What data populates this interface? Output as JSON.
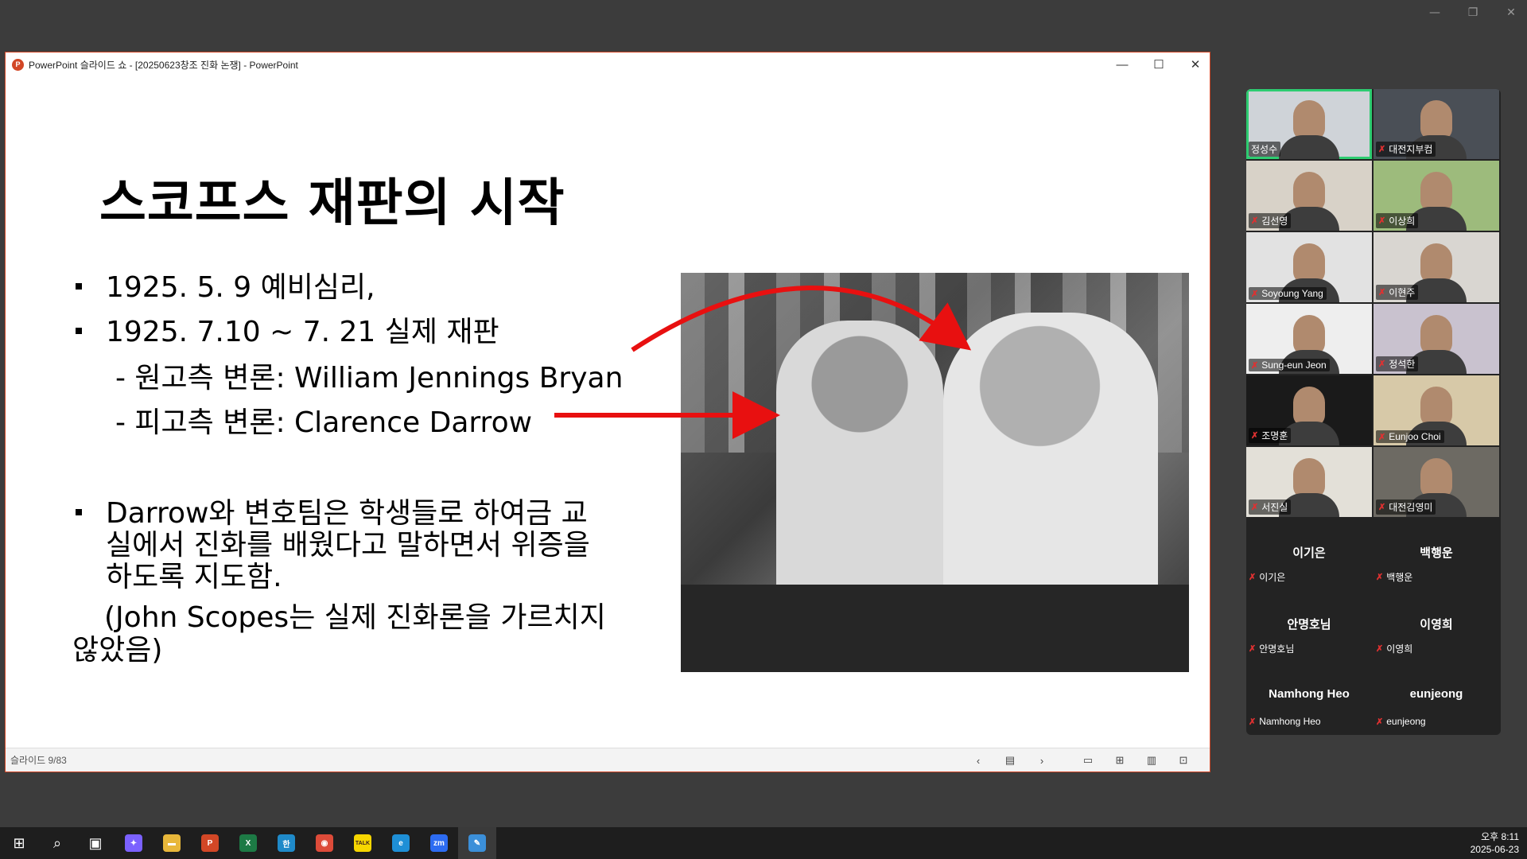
{
  "ppt": {
    "window_title": "PowerPoint 슬라이드 쇼 - [20250623창조 진화 논쟁] - PowerPoint",
    "logo_letter": "P",
    "minimize": "—",
    "maximize": "☐",
    "close": "✕"
  },
  "slide": {
    "title": "스코프스 재판의 시작",
    "bullet1": "1925. 5. 9   예비심리,",
    "bullet2": "1925. 7.10 ~ 7. 21   실제 재판",
    "sub1": "- 원고측 변론: William Jennings Bryan",
    "sub2": "- 피고측 변론: Clarence Darrow",
    "bullet3_line1": "Darrow와 변호팀은 학생들로 하여금 교",
    "bullet3_line2": "실에서 진화를 배웠다고 말하면서 위증을",
    "bullet3_line3": "하도록 지도함.",
    "note_line1": "(John Scopes는 실제 진화론을 가르치지",
    "note_line2": "않았음)",
    "arrow_color": "#e81010"
  },
  "statusbar": {
    "slide_counter": "슬라이드 9/83",
    "icons": [
      "chevron-left-icon",
      "notes-icon",
      "chevron-right-icon",
      "normal-view-icon",
      "slide-sorter-icon",
      "reading-view-icon",
      "slideshow-icon"
    ]
  },
  "participants": {
    "video_tiles": [
      {
        "name": "정성수",
        "muted": false,
        "active": true,
        "bg": "#cfd3d8"
      },
      {
        "name": "대전지부컴",
        "muted": true,
        "active": false,
        "bg": "#4a4f56"
      },
      {
        "name": "김선영",
        "muted": true,
        "active": false,
        "bg": "#d8d2c8"
      },
      {
        "name": "이상희",
        "muted": true,
        "active": false,
        "bg": "#9dbb7c"
      },
      {
        "name": "Soyoung Yang",
        "muted": true,
        "active": false,
        "bg": "#e2e2e2"
      },
      {
        "name": "이현주",
        "muted": true,
        "active": false,
        "bg": "#d9d6d1"
      },
      {
        "name": "Sung-eun Jeon",
        "muted": true,
        "active": false,
        "bg": "#eeeeee"
      },
      {
        "name": "정석한",
        "muted": true,
        "active": false,
        "bg": "#c9c2cf"
      },
      {
        "name": "조명훈",
        "muted": true,
        "active": false,
        "bg": "#1a1a1a"
      },
      {
        "name": "Eunjoo Choi",
        "muted": true,
        "active": false,
        "bg": "#d7c9a8"
      },
      {
        "name": "서진실",
        "muted": true,
        "active": false,
        "bg": "#e3e0d8"
      },
      {
        "name": "대전김영미",
        "muted": true,
        "active": false,
        "bg": "#6d6a63"
      }
    ],
    "audio_tiles": [
      {
        "display": "이기은",
        "name": "이기은"
      },
      {
        "display": "백행운",
        "name": "백행운"
      },
      {
        "display": "안명호님",
        "name": "안명호님"
      },
      {
        "display": "이영희",
        "name": "이영희"
      },
      {
        "display": "Namhong Heo",
        "name": "Namhong Heo"
      },
      {
        "display": "eunjeong",
        "name": "eunjeong"
      }
    ],
    "muted_mic_glyph": "✗"
  },
  "taskbar": {
    "apps": [
      {
        "icon": "windows-start-icon",
        "glyph": "⊞",
        "color": "#1e1e1e"
      },
      {
        "icon": "search-icon",
        "glyph": "⌕",
        "color": "#1e1e1e"
      },
      {
        "icon": "task-view-icon",
        "glyph": "▣",
        "color": "#1e1e1e"
      },
      {
        "icon": "copilot-icon",
        "glyph": "✦",
        "color": "#7b61ff"
      },
      {
        "icon": "file-explorer-icon",
        "glyph": "▬",
        "color": "#e8b73a"
      },
      {
        "icon": "powerpoint-icon",
        "glyph": "P",
        "color": "#d24726"
      },
      {
        "icon": "excel-icon",
        "glyph": "X",
        "color": "#1d7a45"
      },
      {
        "icon": "hancom-icon",
        "glyph": "한",
        "color": "#1f8ac9"
      },
      {
        "icon": "chrome-icon",
        "glyph": "◉",
        "color": "#dd4b39"
      },
      {
        "icon": "kakaotalk-icon",
        "glyph": "TALK",
        "color": "#f7d600"
      },
      {
        "icon": "edge-icon",
        "glyph": "e",
        "color": "#1e8fd6"
      },
      {
        "icon": "zoom-icon",
        "glyph": "zm",
        "color": "#2d6cf2"
      },
      {
        "icon": "whiteboard-icon",
        "glyph": "✎",
        "color": "#3b8fd9"
      }
    ],
    "selected_index": 12,
    "time": "오후 8:11",
    "date": "2025-06-23"
  }
}
